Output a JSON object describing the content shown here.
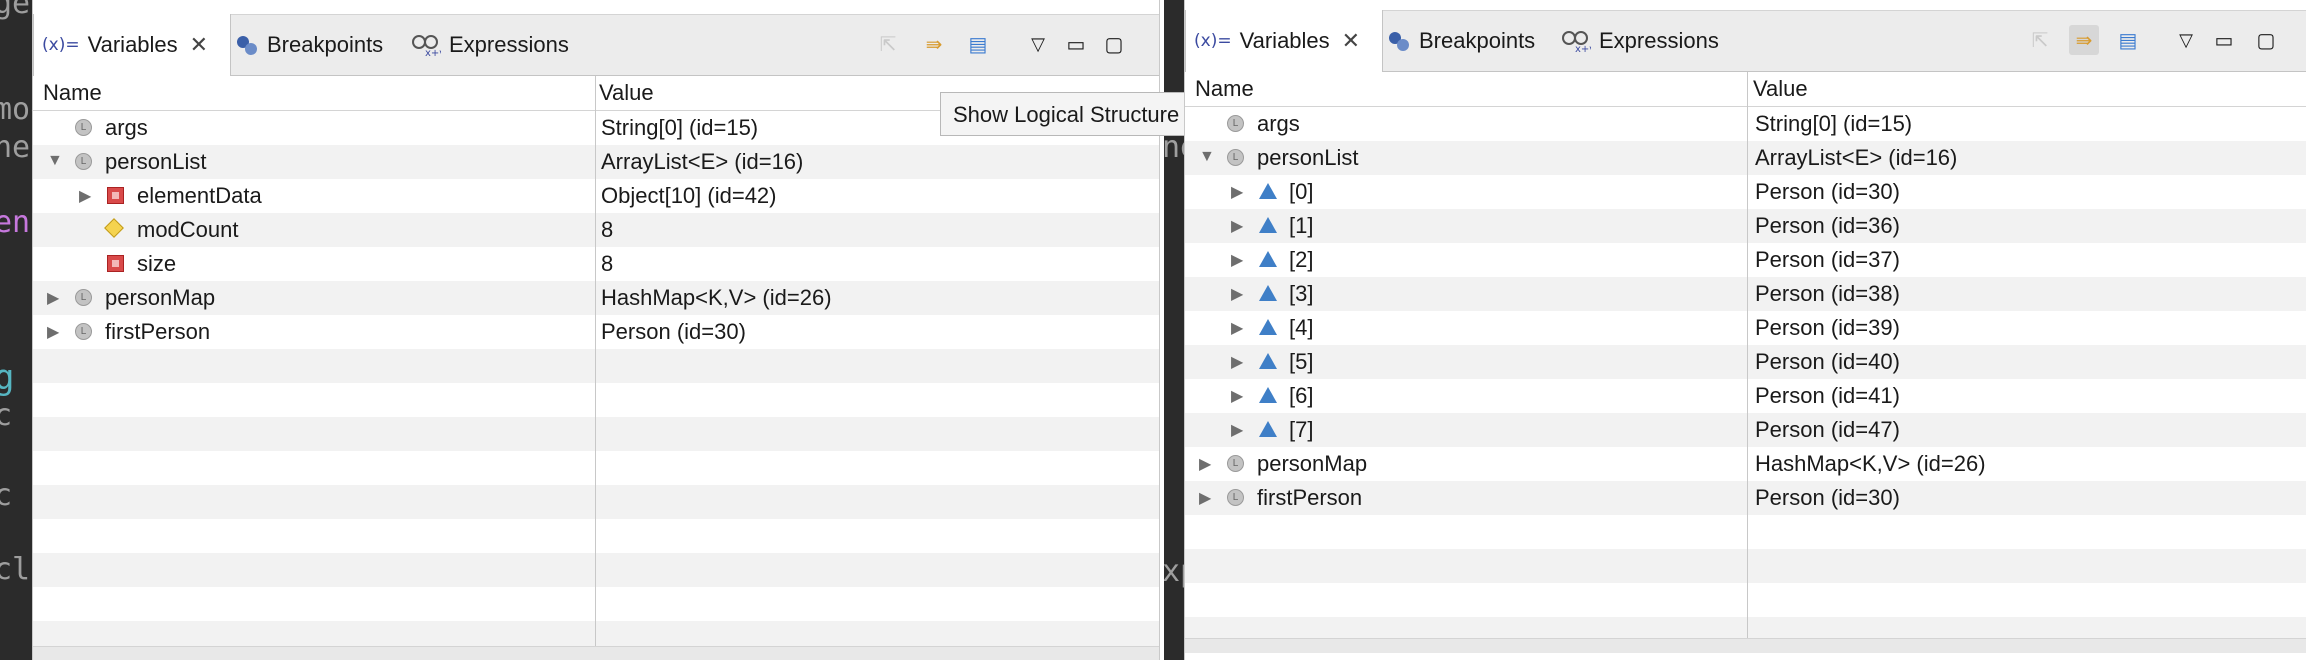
{
  "background_editor": {
    "left_fragments": [
      "ge",
      "mod",
      "he",
      "enS",
      "g",
      "c",
      "c",
      "cli"
    ],
    "mid_fragments": [
      "I",
      "ne",
      "xp"
    ]
  },
  "panels": [
    {
      "tabs": [
        {
          "label": "Variables",
          "icon": "(x)=",
          "active": true
        },
        {
          "label": "Breakpoints",
          "icon": "breakpoints-icon"
        },
        {
          "label": "Expressions",
          "icon": "expressions-icon"
        }
      ],
      "columns": {
        "name": "Name",
        "value": "Value"
      },
      "tooltip": "Show Logical Structure",
      "rows": [
        {
          "name": "args",
          "value": "String[0]  (id=15)",
          "icon": "local",
          "twisty": ""
        },
        {
          "name": "personList",
          "value": "ArrayList<E>  (id=16)",
          "icon": "local",
          "twisty": "expanded"
        },
        {
          "name": "elementData",
          "value": "Object[10]  (id=42)",
          "icon": "private",
          "twisty": "collapsed"
        },
        {
          "name": "modCount",
          "value": "8",
          "icon": "protected",
          "twisty": ""
        },
        {
          "name": "size",
          "value": "8",
          "icon": "private",
          "twisty": ""
        },
        {
          "name": "personMap",
          "value": "HashMap<K,V>  (id=26)",
          "icon": "local",
          "twisty": "collapsed"
        },
        {
          "name": "firstPerson",
          "value": "Person  (id=30)",
          "icon": "local",
          "twisty": "collapsed"
        }
      ]
    },
    {
      "tabs": [
        {
          "label": "Variables",
          "icon": "(x)=",
          "active": true
        },
        {
          "label": "Breakpoints",
          "icon": "breakpoints-icon"
        },
        {
          "label": "Expressions",
          "icon": "expressions-icon"
        }
      ],
      "columns": {
        "name": "Name",
        "value": "Value"
      },
      "rows": [
        {
          "name": "args",
          "value": "String[0]  (id=15)",
          "icon": "local",
          "twisty": ""
        },
        {
          "name": "personList",
          "value": "ArrayList<E>  (id=16)",
          "icon": "local",
          "twisty": "expanded"
        },
        {
          "name": "[0]",
          "value": "Person  (id=30)",
          "icon": "element",
          "twisty": "collapsed"
        },
        {
          "name": "[1]",
          "value": "Person  (id=36)",
          "icon": "element",
          "twisty": "collapsed"
        },
        {
          "name": "[2]",
          "value": "Person  (id=37)",
          "icon": "element",
          "twisty": "collapsed"
        },
        {
          "name": "[3]",
          "value": "Person  (id=38)",
          "icon": "element",
          "twisty": "collapsed"
        },
        {
          "name": "[4]",
          "value": "Person  (id=39)",
          "icon": "element",
          "twisty": "collapsed"
        },
        {
          "name": "[5]",
          "value": "Person  (id=40)",
          "icon": "element",
          "twisty": "collapsed"
        },
        {
          "name": "[6]",
          "value": "Person  (id=41)",
          "icon": "element",
          "twisty": "collapsed"
        },
        {
          "name": "[7]",
          "value": "Person  (id=47)",
          "icon": "element",
          "twisty": "collapsed"
        },
        {
          "name": "personMap",
          "value": "HashMap<K,V>  (id=26)",
          "icon": "local",
          "twisty": "collapsed"
        },
        {
          "name": "firstPerson",
          "value": "Person  (id=30)",
          "icon": "local",
          "twisty": "collapsed"
        }
      ]
    }
  ],
  "colors": {
    "stripe": "#f2f2f2",
    "tabbar": "#ececec",
    "editor": "#2b2b2b"
  }
}
